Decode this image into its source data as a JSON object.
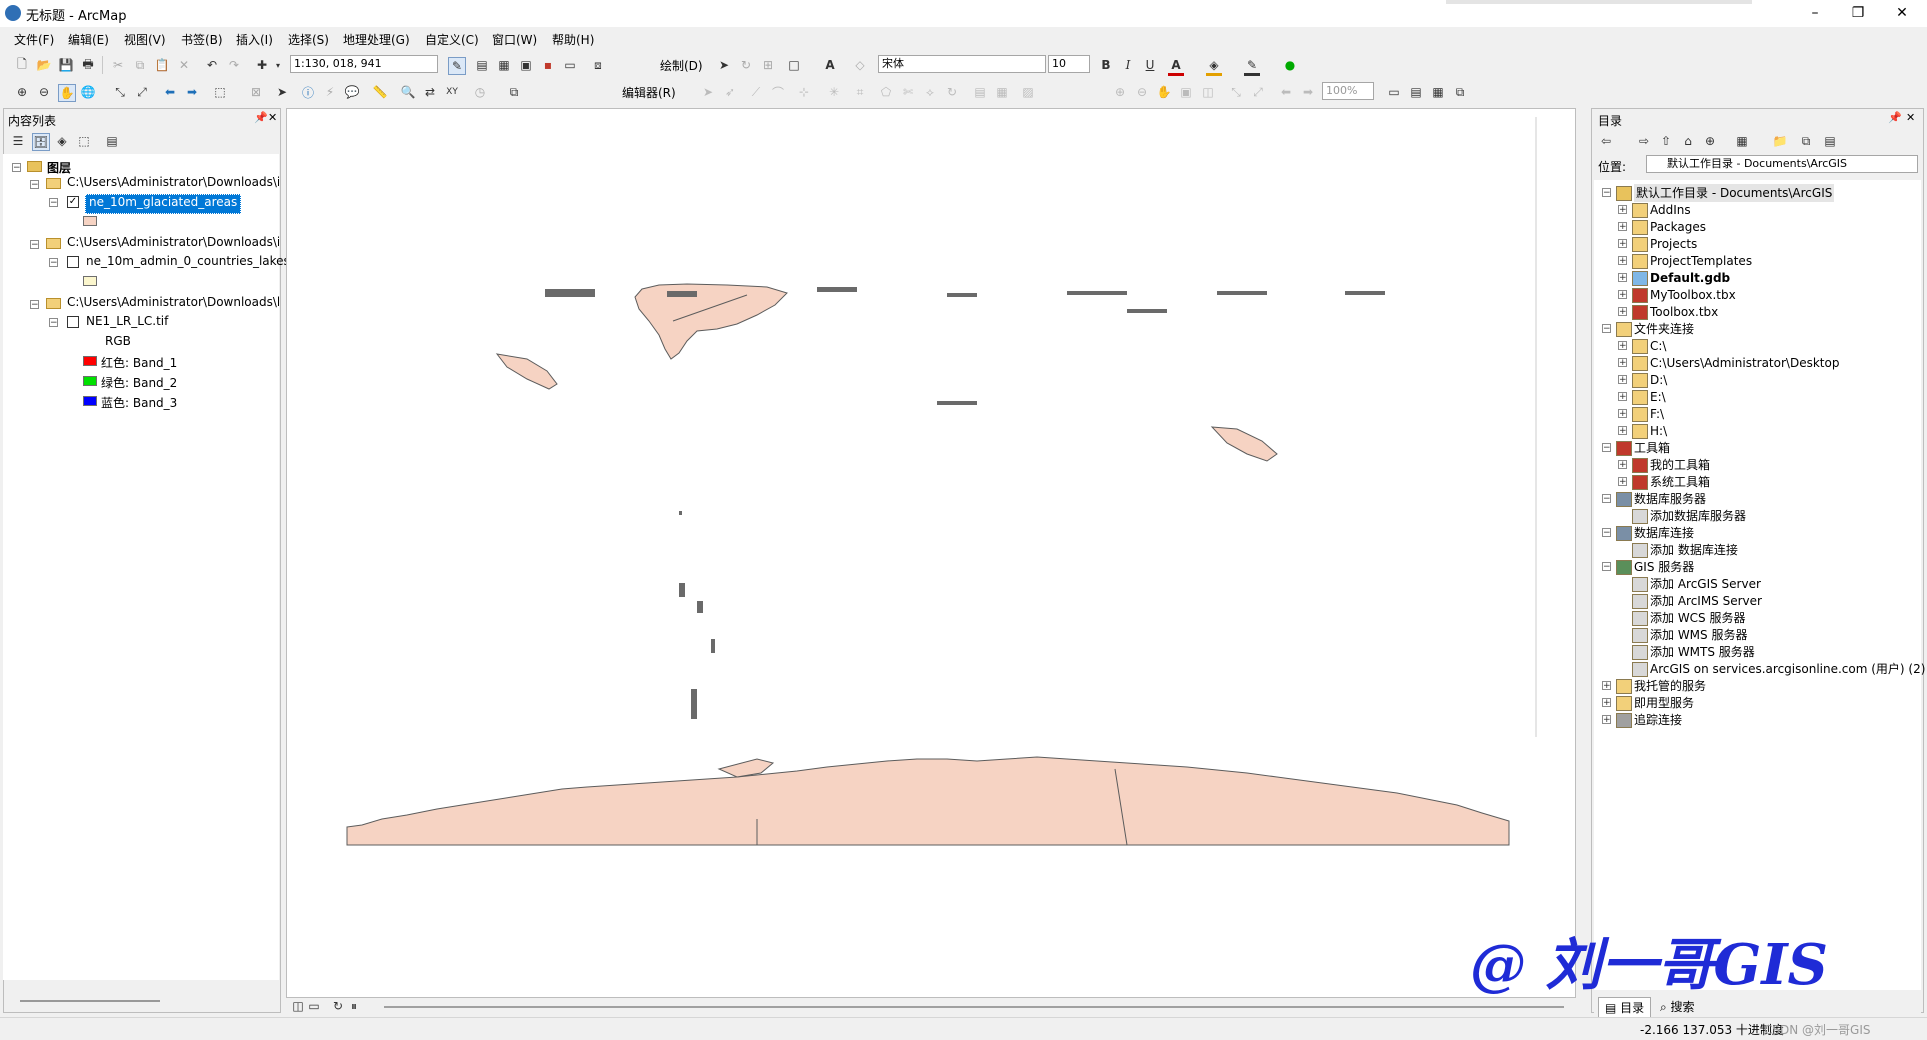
{
  "window": {
    "title": "无标题 - ArcMap",
    "minimize": "–",
    "maximize": "❐",
    "close": "✕"
  },
  "menu": [
    "文件(F)",
    "编辑(E)",
    "视图(V)",
    "书签(B)",
    "插入(I)",
    "选择(S)",
    "地理处理(G)",
    "自定义(C)",
    "窗口(W)",
    "帮助(H)"
  ],
  "toolbar1": {
    "scale": "1:130, 018, 941",
    "draw_label": "绘制(D)",
    "font_name": "宋体",
    "font_size": "10",
    "bold": "B",
    "italic": "I",
    "underline": "U",
    "font_color": "A"
  },
  "toolbar2": {
    "editor_label": "编辑器(R)",
    "zoom_percent": "100%"
  },
  "toc": {
    "title": "内容列表",
    "root_label": "图层",
    "groups": [
      {
        "path": "C:\\Users\\Administrator\\Downloads\\i",
        "layer": "ne_10m_glaciated_areas",
        "checked": true,
        "swatch": "#f6d3c3"
      },
      {
        "path": "C:\\Users\\Administrator\\Downloads\\i",
        "layer": "ne_10m_admin_0_countries_lakes",
        "checked": false,
        "swatch": "#fbf6cd"
      },
      {
        "path": "C:\\Users\\Administrator\\Downloads\\l",
        "layer": "NE1_LR_LC.tif",
        "checked": false
      }
    ],
    "rgb_label": "RGB",
    "bands": [
      {
        "label": "红色:   Band_1",
        "color": "#ff0000"
      },
      {
        "label": "绿色: Band_2",
        "color": "#00e000"
      },
      {
        "label": "蓝色:   Band_3",
        "color": "#0000ff"
      }
    ]
  },
  "catalog": {
    "title": "目录",
    "location_label": "位置:",
    "location_value": "默认工作目录 - Documents\\ArcGIS",
    "items": [
      {
        "label": "默认工作目录 - Documents\\ArcGIS",
        "level": 0,
        "toggle": "−",
        "icon": "folder-home",
        "bold": false,
        "selected": true
      },
      {
        "label": "AddIns",
        "level": 1,
        "toggle": "+",
        "icon": "folder"
      },
      {
        "label": "Packages",
        "level": 1,
        "toggle": "+",
        "icon": "folder"
      },
      {
        "label": "Projects",
        "level": 1,
        "toggle": "+",
        "icon": "folder"
      },
      {
        "label": "ProjectTemplates",
        "level": 1,
        "toggle": "+",
        "icon": "folder"
      },
      {
        "label": "Default.gdb",
        "level": 1,
        "toggle": "+",
        "icon": "gdb",
        "bold": true
      },
      {
        "label": "MyToolbox.tbx",
        "level": 1,
        "toggle": "+",
        "icon": "toolbox"
      },
      {
        "label": "Toolbox.tbx",
        "level": 1,
        "toggle": "+",
        "icon": "toolbox"
      },
      {
        "label": "文件夹连接",
        "level": 0,
        "toggle": "−",
        "icon": "folder-connection"
      },
      {
        "label": "C:\\",
        "level": 1,
        "toggle": "+",
        "icon": "folder"
      },
      {
        "label": "C:\\Users\\Administrator\\Desktop",
        "level": 1,
        "toggle": "+",
        "icon": "folder"
      },
      {
        "label": "D:\\",
        "level": 1,
        "toggle": "+",
        "icon": "folder"
      },
      {
        "label": "E:\\",
        "level": 1,
        "toggle": "+",
        "icon": "folder"
      },
      {
        "label": "F:\\",
        "level": 1,
        "toggle": "+",
        "icon": "folder"
      },
      {
        "label": "H:\\",
        "level": 1,
        "toggle": "+",
        "icon": "folder"
      },
      {
        "label": "工具箱",
        "level": 0,
        "toggle": "−",
        "icon": "toolbox"
      },
      {
        "label": "我的工具箱",
        "level": 1,
        "toggle": "+",
        "icon": "toolbox"
      },
      {
        "label": "系统工具箱",
        "level": 1,
        "toggle": "+",
        "icon": "toolbox"
      },
      {
        "label": "数据库服务器",
        "level": 0,
        "toggle": "−",
        "icon": "db-server"
      },
      {
        "label": "添加数据库服务器",
        "level": 1,
        "toggle": "",
        "icon": "add"
      },
      {
        "label": "数据库连接",
        "level": 0,
        "toggle": "−",
        "icon": "db-connection"
      },
      {
        "label": "添加 数据库连接",
        "level": 1,
        "toggle": "",
        "icon": "add"
      },
      {
        "label": "GIS 服务器",
        "level": 0,
        "toggle": "−",
        "icon": "gis-server"
      },
      {
        "label": "添加 ArcGIS Server",
        "level": 1,
        "toggle": "",
        "icon": "add"
      },
      {
        "label": "添加 ArcIMS Server",
        "level": 1,
        "toggle": "",
        "icon": "add"
      },
      {
        "label": "添加 WCS 服务器",
        "level": 1,
        "toggle": "",
        "icon": "add"
      },
      {
        "label": "添加 WMS 服务器",
        "level": 1,
        "toggle": "",
        "icon": "add"
      },
      {
        "label": "添加 WMTS 服务器",
        "level": 1,
        "toggle": "",
        "icon": "add"
      },
      {
        "label": "ArcGIS on services.arcgisonline.com (用户) (2)",
        "level": 1,
        "toggle": "",
        "icon": "add"
      },
      {
        "label": "我托管的服务",
        "level": 0,
        "toggle": "+",
        "icon": "folder"
      },
      {
        "label": "即用型服务",
        "level": 0,
        "toggle": "+",
        "icon": "folder"
      },
      {
        "label": "追踪连接",
        "level": 0,
        "toggle": "+",
        "icon": "tracking"
      }
    ],
    "tabs": [
      "目录",
      "搜索"
    ]
  },
  "watermark": "@ 刘一哥GIS",
  "status": {
    "coords": "-2.166  137.053 十进制度",
    "csdn": "CSDN @刘一哥GIS"
  },
  "colors": {
    "polygon_fill": "#f6d3c3",
    "polygon_stroke": "#5c5c5c",
    "selection": "#0078d7",
    "watermark": "#1f2bd6"
  }
}
